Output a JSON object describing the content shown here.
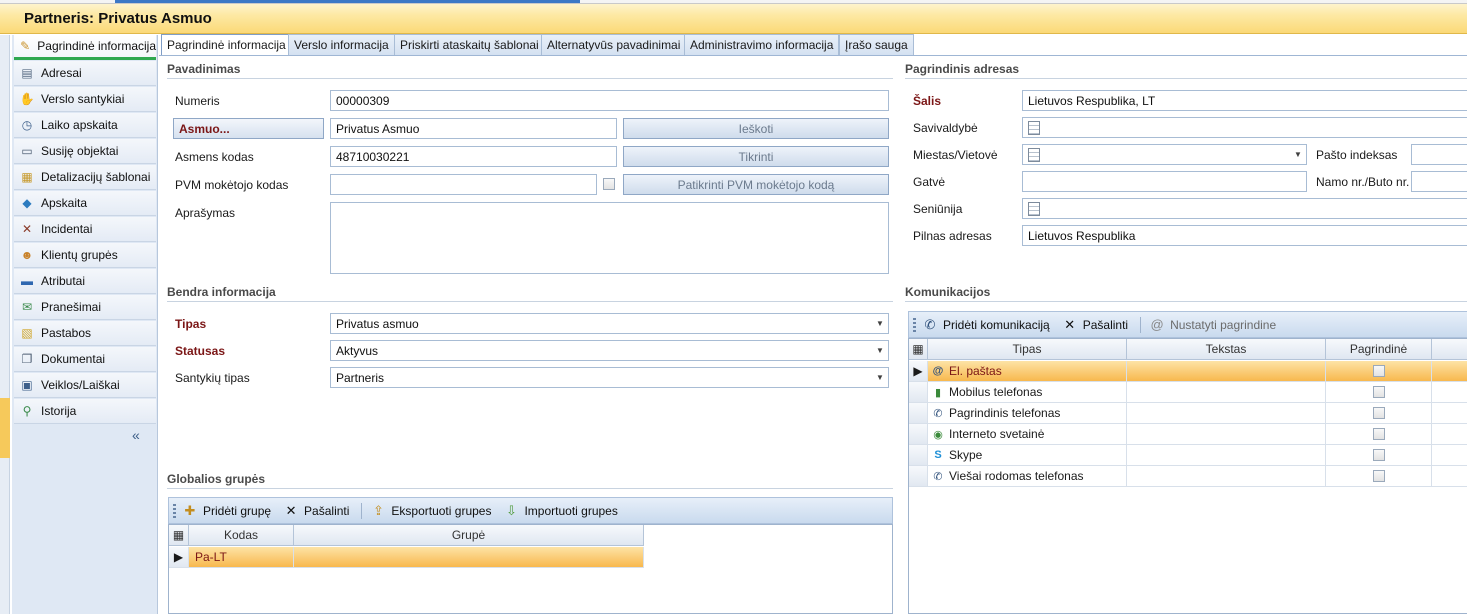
{
  "window": {
    "title": "Partneris: Privatus Asmuo"
  },
  "sidebar": {
    "items": [
      {
        "label": "Pagrindinė informacija",
        "icon": "home-icon"
      },
      {
        "label": "Adresai",
        "icon": "address-icon"
      },
      {
        "label": "Verslo santykiai",
        "icon": "handshake-icon"
      },
      {
        "label": "Laiko apskaita",
        "icon": "clock-icon"
      },
      {
        "label": "Susiję objektai",
        "icon": "document-icon"
      },
      {
        "label": "Detalizacijų šablonai",
        "icon": "template-icon"
      },
      {
        "label": "Apskaita",
        "icon": "accounting-icon"
      },
      {
        "label": "Incidentai",
        "icon": "tools-icon"
      },
      {
        "label": "Klientų grupės",
        "icon": "group-icon"
      },
      {
        "label": "Atributai",
        "icon": "attributes-icon"
      },
      {
        "label": "Pranešimai",
        "icon": "message-icon"
      },
      {
        "label": "Pastabos",
        "icon": "note-icon"
      },
      {
        "label": "Dokumentai",
        "icon": "documents-icon"
      },
      {
        "label": "Veiklos/Laiškai",
        "icon": "activity-icon"
      },
      {
        "label": "Istorija",
        "icon": "history-icon"
      }
    ],
    "collapse_glyph": "«"
  },
  "tabs": [
    "Pagrindinė informacija",
    "Verslo informacija",
    "Priskirti ataskaitų šablonai",
    "Alternatyvūs pavadinimai",
    "Administravimo informacija",
    "Įrašo sauga"
  ],
  "naming": {
    "section": "Pavadinimas",
    "number_label": "Numeris",
    "number_value": "00000309",
    "person_button": "Asmuo...",
    "person_value": "Privatus Asmuo",
    "search_button": "Ieškoti",
    "personal_code_label": "Asmens kodas",
    "personal_code_value": "48710030221",
    "check_button": "Tikrinti",
    "vat_label": "PVM mokėtojo kodas",
    "vat_value": "",
    "vat_check_button": "Patikrinti PVM mokėtojo kodą",
    "description_label": "Aprašymas",
    "description_value": ""
  },
  "general": {
    "section": "Bendra informacija",
    "type_label": "Tipas",
    "type_value": "Privatus asmuo",
    "status_label": "Statusas",
    "status_value": "Aktyvus",
    "relation_label": "Santykių tipas",
    "relation_value": "Partneris"
  },
  "global_groups": {
    "section": "Globalios grupės",
    "toolbar": {
      "add": "Pridėti grupę",
      "remove": "Pašalinti",
      "export": "Eksportuoti grupes",
      "import": "Importuoti grupes"
    },
    "columns": [
      "Kodas",
      "Grupė"
    ],
    "rows": [
      {
        "code": "Pa-LT",
        "group": ""
      }
    ]
  },
  "address": {
    "section": "Pagrindinis adresas",
    "country_label": "Šalis",
    "country_value": "Lietuvos Respublika, LT",
    "municipality_label": "Savivaldybė",
    "city_label": "Miestas/Vietovė",
    "postal_label": "Pašto indeksas",
    "street_label": "Gatvė",
    "house_label": "Namo nr./Buto nr.",
    "eldership_label": "Seniūnija",
    "full_label": "Pilnas adresas",
    "full_value": "Lietuvos Respublika"
  },
  "communications": {
    "section": "Komunikacijos",
    "toolbar": {
      "add": "Pridėti komunikaciją",
      "remove": "Pašalinti",
      "set_primary": "Nustatyti pagrindine"
    },
    "columns": [
      "Tipas",
      "Tekstas",
      "Pagrindinė"
    ],
    "rows": [
      {
        "type": "El. paštas",
        "icon": "email-icon",
        "text": ""
      },
      {
        "type": "Mobilus telefonas",
        "icon": "mobile-phone-icon",
        "text": ""
      },
      {
        "type": "Pagrindinis telefonas",
        "icon": "phone-icon",
        "text": ""
      },
      {
        "type": "Interneto svetainė",
        "icon": "globe-icon",
        "text": ""
      },
      {
        "type": "Skype",
        "icon": "skype-icon",
        "text": ""
      },
      {
        "type": "Viešai rodomas telefonas",
        "icon": "phone-icon",
        "text": ""
      }
    ]
  }
}
